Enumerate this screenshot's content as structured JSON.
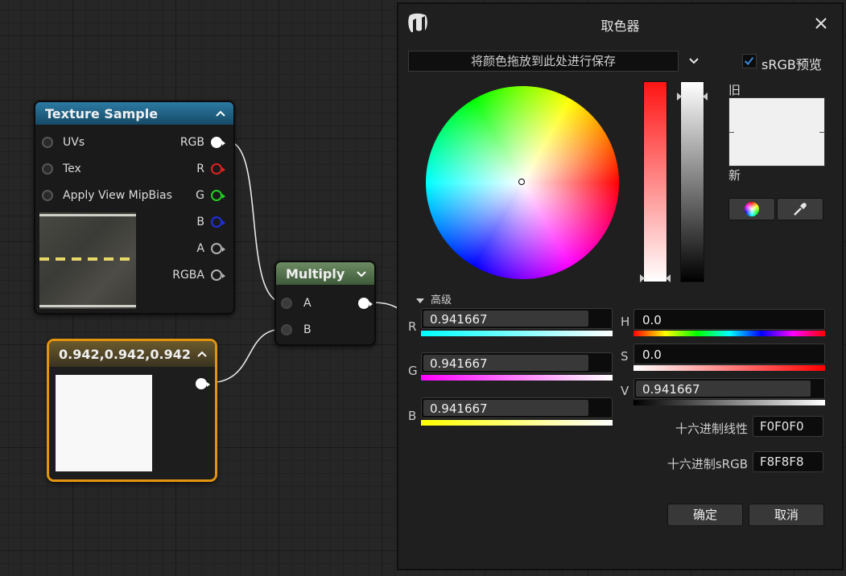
{
  "texture_node": {
    "title": "Texture Sample",
    "inputs": [
      "UVs",
      "Tex",
      "Apply View MipBias"
    ],
    "outputs": [
      {
        "label": "RGB",
        "color": "#ffffff"
      },
      {
        "label": "R",
        "color": "#e02020"
      },
      {
        "label": "G",
        "color": "#20d020"
      },
      {
        "label": "B",
        "color": "#2030e0"
      },
      {
        "label": "A",
        "color": "#b0b0b0"
      },
      {
        "label": "RGBA",
        "color": "#b0b0b0"
      }
    ],
    "header_color": "#1f5d7e"
  },
  "multiply_node": {
    "title": "Multiply",
    "inputs": [
      "A",
      "B"
    ],
    "header_color": "#4d6b47"
  },
  "constant_node": {
    "title": "0.942,0.942,0.942",
    "swatch_color": "#f8f8f8",
    "border_color": "#e3940f"
  },
  "picker": {
    "title": "取色器",
    "drop_zone": "将颜色拖放到此处进行保存",
    "srgb_preview": {
      "label": "sRGB预览",
      "checked": true
    },
    "old_label": "旧",
    "new_label": "新",
    "color_swatch": "#f0f0f0",
    "advanced_label": "高级",
    "rgb": [
      {
        "channel": "R",
        "value": "0.941667",
        "level": 0.941667,
        "gradient": [
          "#00ffff",
          "#ffffff"
        ]
      },
      {
        "channel": "G",
        "value": "0.941667",
        "level": 0.941667,
        "gradient": [
          "#ff00ff",
          "#ffffff"
        ]
      },
      {
        "channel": "B",
        "value": "0.941667",
        "level": 0.941667,
        "gradient": [
          "#ffff00",
          "#ffffff"
        ]
      }
    ],
    "hsv": [
      {
        "channel": "H",
        "value": "0.0",
        "level": 0.0
      },
      {
        "channel": "S",
        "value": "0.0",
        "level": 0.0
      },
      {
        "channel": "V",
        "value": "0.941667",
        "level": 0.941667
      }
    ],
    "hex_linear": {
      "label": "十六进制线性",
      "value": "F0F0F0"
    },
    "hex_srgb": {
      "label": "十六进制sRGB",
      "value": "F8F8F8"
    },
    "ok_label": "确定",
    "cancel_label": "取消"
  }
}
